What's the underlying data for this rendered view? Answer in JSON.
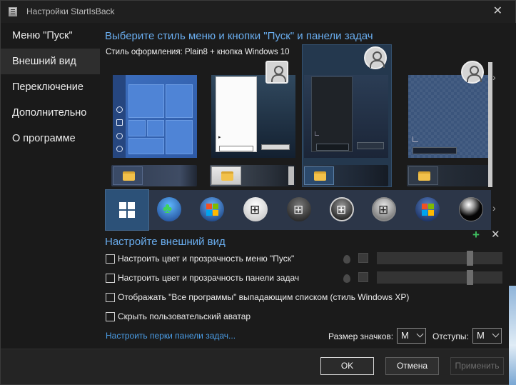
{
  "window": {
    "title": "Настройки StartIsBack"
  },
  "sidebar": {
    "items": [
      {
        "label": "Меню \"Пуск\""
      },
      {
        "label": "Внешний вид"
      },
      {
        "label": "Переключение"
      },
      {
        "label": "Дополнительно"
      },
      {
        "label": "О программе"
      }
    ],
    "active_index": 1
  },
  "main": {
    "heading": "Выберите стиль меню и кнопки \"Пуск\" и панели задач",
    "style_label": "Стиль оформления:",
    "style_value": "Plain8 + кнопка Windows 10",
    "styles": [
      "windows-10-style",
      "plain8-light-style",
      "plain8-dark-style",
      "glass-grid-style"
    ],
    "selected_style_index": 2,
    "start_buttons": [
      "windows-10-flag",
      "clover-orb",
      "windows-7-orb",
      "white-windows-orb",
      "dark-windows-orb",
      "black-windows-orb",
      "silver-windows-orb",
      "vista-orb",
      "black-sphere-orb"
    ],
    "selected_button_index": 0,
    "customize_heading": "Настройте внешний вид",
    "options": [
      {
        "label": "Настроить цвет и прозрачность меню \"Пуск\"",
        "checked": false
      },
      {
        "label": "Настроить цвет и прозрачность панели задач",
        "checked": false
      },
      {
        "label": "Отображать \"Все программы\" выпадающим списком (стиль Windows XP)",
        "checked": false
      },
      {
        "label": "Скрыть пользовательский аватар",
        "checked": false
      }
    ],
    "taskbar_perks_link": "Настроить перки панели задач...",
    "icon_size_label": "Размер значков:",
    "icon_size_value": "M",
    "padding_label": "Отступы:",
    "padding_value": "M"
  },
  "footer": {
    "ok_label": "OK",
    "cancel_label": "Отмена",
    "apply_label": "Применить"
  },
  "colors": {
    "accent_heading": "#6aaef0",
    "link": "#4b9de6",
    "selection": "#24384e",
    "add_green": "#3fbf5f"
  }
}
